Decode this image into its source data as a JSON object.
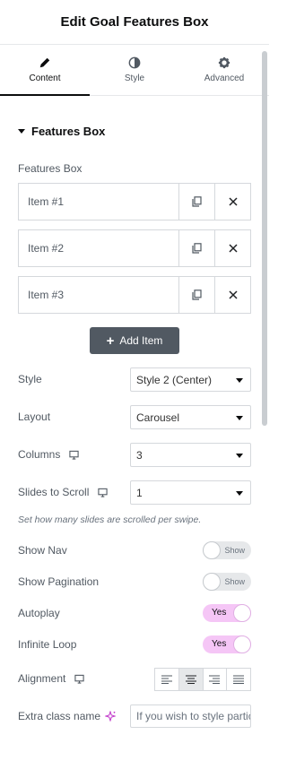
{
  "header": {
    "title": "Edit Goal Features Box"
  },
  "tabs": [
    {
      "label": "Content",
      "icon": "pencil-icon",
      "active": true
    },
    {
      "label": "Style",
      "icon": "half-circle-icon",
      "active": false
    },
    {
      "label": "Advanced",
      "icon": "gear-icon",
      "active": false
    }
  ],
  "section": {
    "title": "Features Box"
  },
  "repeater": {
    "label": "Features Box",
    "items": [
      {
        "title": "Item #1"
      },
      {
        "title": "Item #2"
      },
      {
        "title": "Item #3"
      }
    ],
    "add_label": "Add Item"
  },
  "controls": {
    "style": {
      "label": "Style",
      "value": "Style 2 (Center)"
    },
    "layout": {
      "label": "Layout",
      "value": "Carousel"
    },
    "columns": {
      "label": "Columns",
      "value": "3"
    },
    "slides_to_scroll": {
      "label": "Slides to Scroll",
      "value": "1",
      "description": "Set how many slides are scrolled per swipe."
    },
    "show_nav": {
      "label": "Show Nav",
      "state": "Show"
    },
    "show_pagination": {
      "label": "Show Pagination",
      "state": "Show"
    },
    "autoplay": {
      "label": "Autoplay",
      "state": "Yes"
    },
    "infinite_loop": {
      "label": "Infinite Loop",
      "state": "Yes"
    },
    "alignment": {
      "label": "Alignment",
      "options": [
        "left",
        "center",
        "right",
        "justify"
      ],
      "selected": "center"
    },
    "extra_class": {
      "label": "Extra class name",
      "placeholder": "If you wish to style particular content element differently"
    }
  },
  "colors": {
    "toggle_on": "#f5c6f6",
    "button": "#515962",
    "ai_accent": "#c036c9"
  }
}
